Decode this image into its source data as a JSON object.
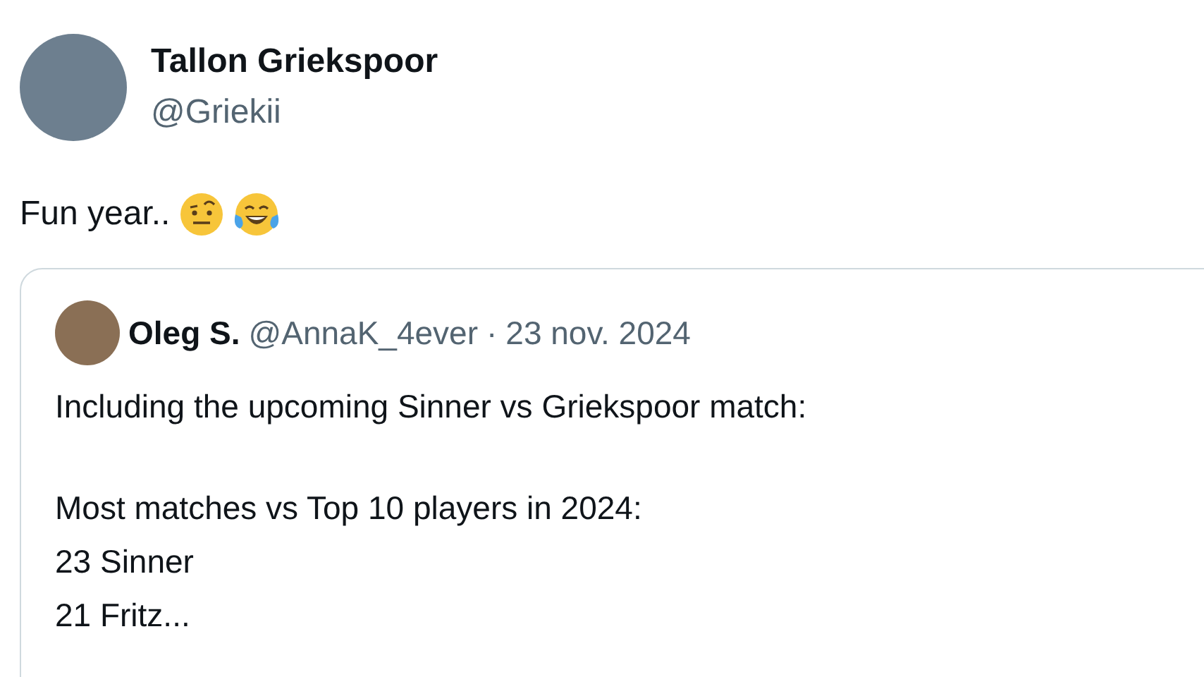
{
  "author": {
    "name": "Tallon Griekspoor",
    "handle": "@Griekii"
  },
  "text": "Fun year..",
  "quoted_tweet": {
    "author": {
      "name": "Oleg S.",
      "handle": "@AnnaK_4ever"
    },
    "separator": "·",
    "date": "23 nov. 2024",
    "paragraphs": [
      [
        "Including the upcoming Sinner vs Griekspoor match:"
      ],
      [
        "Most matches vs Top 10 players in 2024:",
        "23 Sinner",
        "21 Fritz..."
      ]
    ]
  }
}
